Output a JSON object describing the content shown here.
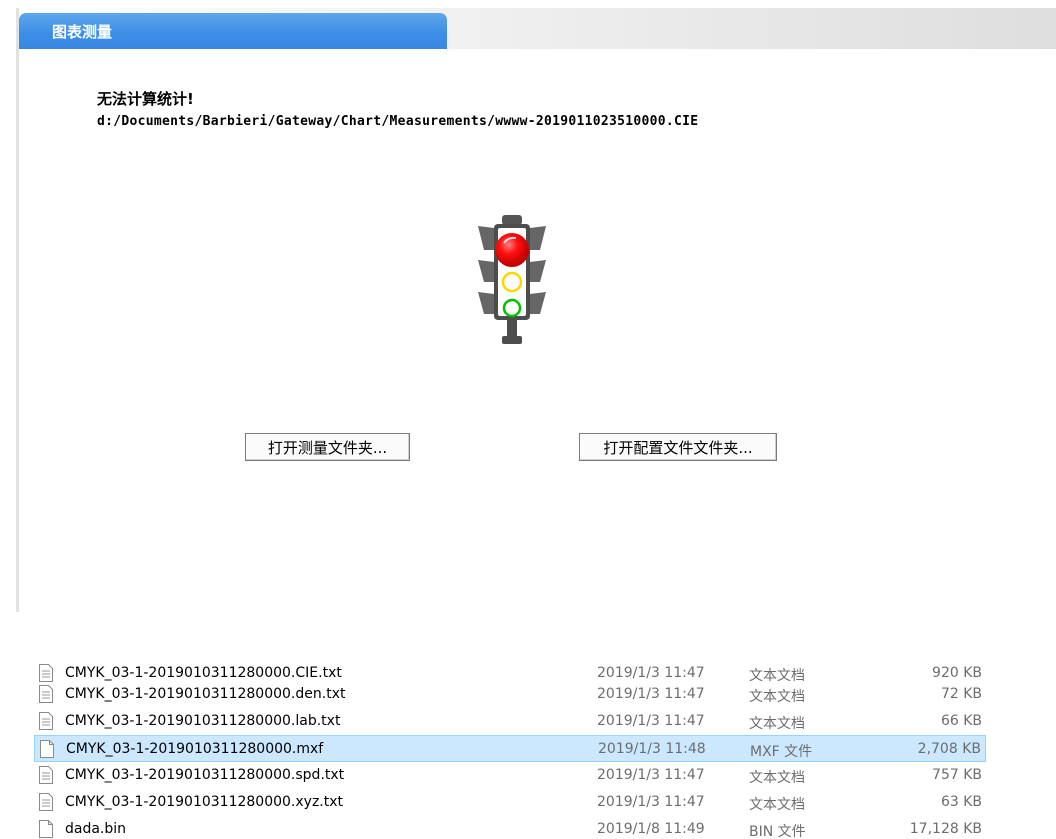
{
  "dialog": {
    "tab_title": "图表测量",
    "error_title": "无法计算统计!",
    "error_path": "d:/Documents/Barbieri/Gateway/Chart/Measurements/wwww-2019011023510000.CIE",
    "status_icon": "traffic-light-red",
    "buttons": {
      "open_measurement_folder": "打开测量文件夹...",
      "open_config_folder": "打开配置文件文件夹..."
    }
  },
  "file_list": {
    "selected_index": 3,
    "rows": [
      {
        "name": "CMYK_03-1-2019010311280000.CIE.txt",
        "date": "2019/1/3 11:47",
        "type": "文本文档",
        "size": "920 KB",
        "icon": "text-file-icon"
      },
      {
        "name": "CMYK_03-1-2019010311280000.den.txt",
        "date": "2019/1/3 11:47",
        "type": "文本文档",
        "size": "72 KB",
        "icon": "text-file-icon"
      },
      {
        "name": "CMYK_03-1-2019010311280000.lab.txt",
        "date": "2019/1/3 11:47",
        "type": "文本文档",
        "size": "66 KB",
        "icon": "text-file-icon"
      },
      {
        "name": "CMYK_03-1-2019010311280000.mxf",
        "date": "2019/1/3 11:48",
        "type": "MXF 文件",
        "size": "2,708 KB",
        "icon": "blank-file-icon"
      },
      {
        "name": "CMYK_03-1-2019010311280000.spd.txt",
        "date": "2019/1/3 11:47",
        "type": "文本文档",
        "size": "757 KB",
        "icon": "text-file-icon"
      },
      {
        "name": "CMYK_03-1-2019010311280000.xyz.txt",
        "date": "2019/1/3 11:47",
        "type": "文本文档",
        "size": "63 KB",
        "icon": "text-file-icon"
      },
      {
        "name": "dada.bin",
        "date": "2019/1/8 11:49",
        "type": "BIN 文件",
        "size": "17,128 KB",
        "icon": "blank-file-icon"
      }
    ]
  },
  "colors": {
    "tab_blue": "#3d8ee6",
    "selection": "#cce8ff",
    "light_red": "#ff0000",
    "light_yellow": "#ffd700",
    "light_green": "#00c000"
  }
}
